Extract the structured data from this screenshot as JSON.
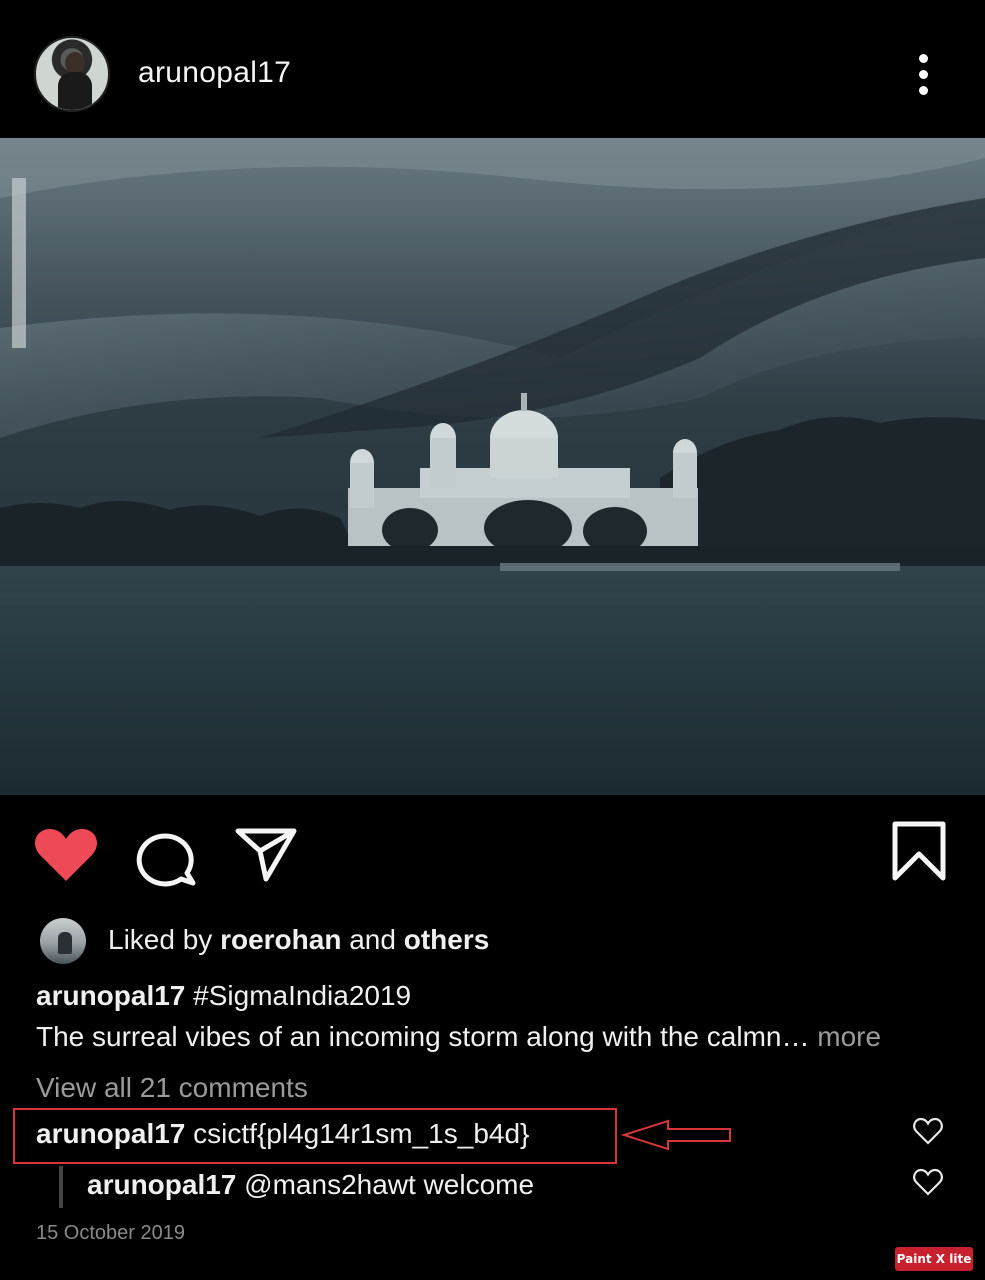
{
  "post": {
    "username": "arunopal17",
    "likes": {
      "prefix": "Liked by ",
      "user": "roerohan",
      "middle": " and ",
      "others": "others"
    },
    "caption": {
      "username": "arunopal17",
      "hashtag": " #SigmaIndia2019",
      "text": "The surreal vibes of an incoming storm along with the calmn…",
      "more_label": " more"
    },
    "view_all_comments": "View all 21 comments",
    "comments": [
      {
        "username": "arunopal17",
        "text": " csictf{pl4g14r1sm_1s_b4d}"
      },
      {
        "username": "arunopal17",
        "text": " @mans2hawt welcome",
        "is_reply": true
      }
    ],
    "date": "15 October 2019"
  },
  "icons": {
    "header_more": "more-vertical-icon",
    "like": "heart-filled-icon",
    "comment": "comment-icon",
    "share": "send-icon",
    "save": "bookmark-icon",
    "comment_like": "heart-outline-icon"
  },
  "colors": {
    "like_red": "#ed4956",
    "annotation_red": "#d9333b",
    "muted_text": "#9a9a9a"
  },
  "watermark": "Paint X lite"
}
